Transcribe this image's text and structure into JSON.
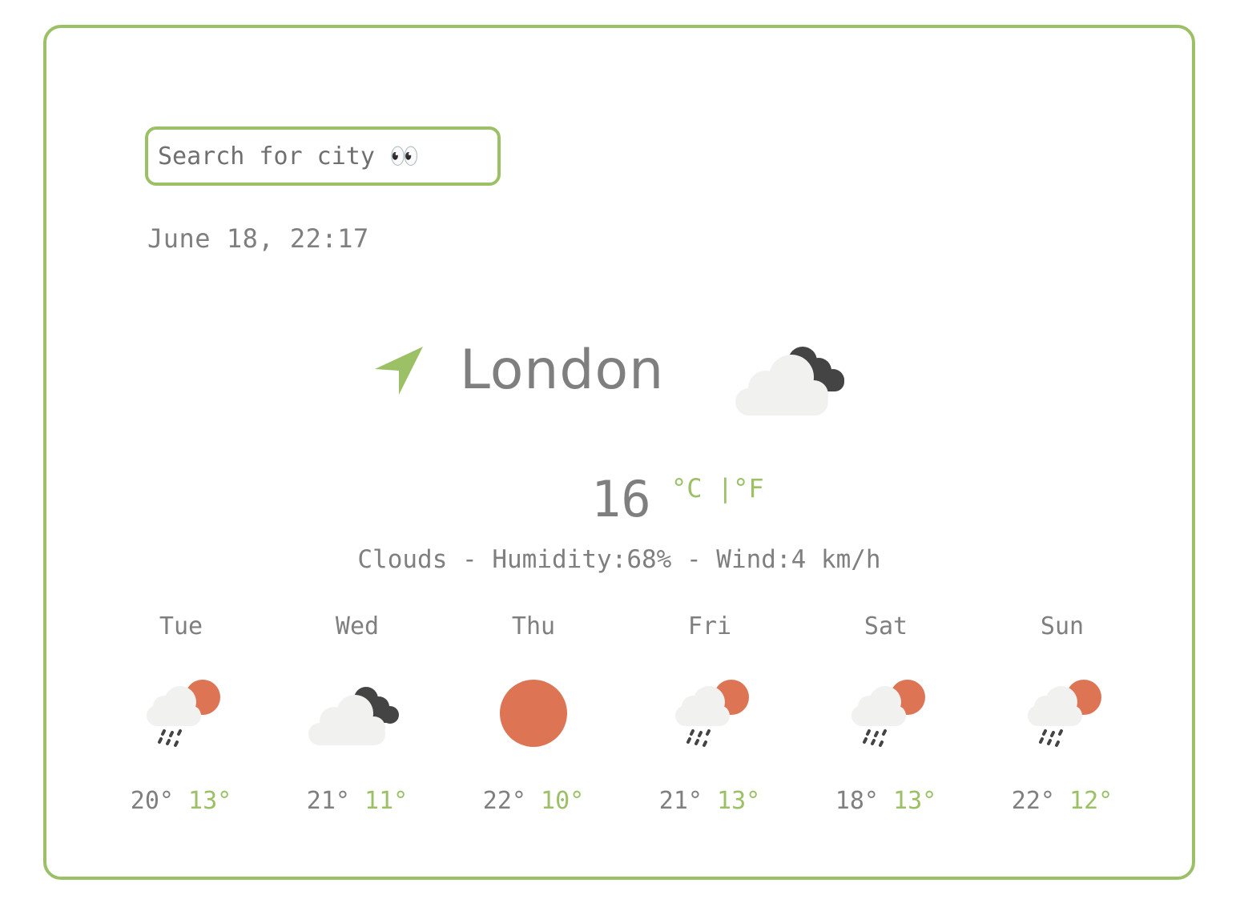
{
  "search": {
    "placeholder": "Search for city 👀"
  },
  "datetime": "June 18, 22:17",
  "current": {
    "city": "London",
    "temperature": "16",
    "unit_celsius": "°C",
    "unit_separator": "|",
    "unit_fahrenheit": "°F",
    "condition_icon": "cloudy-icon",
    "details": "Clouds - Humidity:68% - Wind:4 km/h"
  },
  "forecast": [
    {
      "day": "Tue",
      "high": "20°",
      "low": "13°",
      "icon": "rain-sun-icon"
    },
    {
      "day": "Wed",
      "high": "21°",
      "low": "11°",
      "icon": "cloudy-icon"
    },
    {
      "day": "Thu",
      "high": "22°",
      "low": "10°",
      "icon": "sun-icon"
    },
    {
      "day": "Fri",
      "high": "21°",
      "low": "13°",
      "icon": "rain-sun-icon"
    },
    {
      "day": "Sat",
      "high": "18°",
      "low": "13°",
      "icon": "rain-sun-icon"
    },
    {
      "day": "Sun",
      "high": "22°",
      "low": "12°",
      "icon": "rain-sun-icon"
    }
  ],
  "colors": {
    "accent": "#9bc066",
    "text": "#7f7f7f",
    "sun": "#dd7453",
    "dark_cloud": "#444444",
    "light_cloud": "#f1f1f0"
  }
}
